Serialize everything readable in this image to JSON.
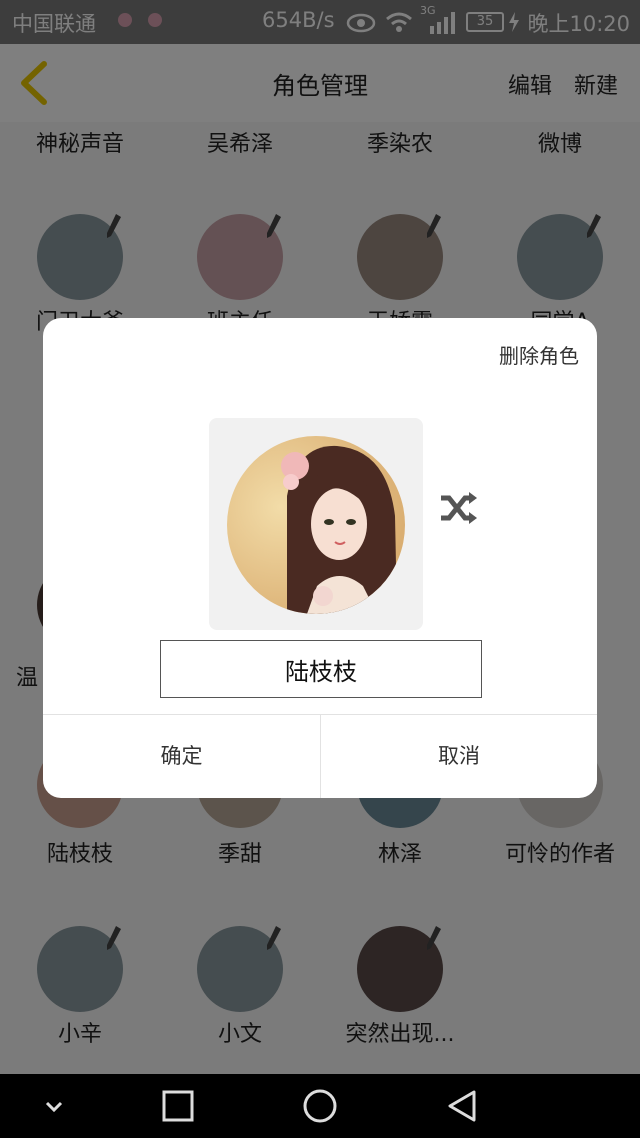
{
  "status_bar": {
    "carrier": "中国联通",
    "network_speed": "654B/s",
    "network_type": "3G",
    "battery": "35",
    "time": "晚上10:20"
  },
  "header": {
    "title": "角色管理",
    "edit_label": "编辑",
    "new_label": "新建",
    "back_icon": "chevron-left-icon",
    "accent_color": "#e8c700"
  },
  "grid": {
    "row0": [
      "神秘声音",
      "吴希泽",
      "季染农",
      "微博"
    ],
    "row1": [
      "门卫大爷",
      "班主任",
      "王娇霞",
      "同学A"
    ],
    "row2_left": "温",
    "row3": [
      "陆枝枝",
      "季甜",
      "林泽",
      "可怜的作者"
    ],
    "row4": [
      "小辛",
      "小文",
      "突然出现..."
    ]
  },
  "dialog": {
    "delete_label": "删除角色",
    "shuffle_icon": "shuffle-icon",
    "name_value": "陆枝枝",
    "confirm_label": "确定",
    "cancel_label": "取消"
  },
  "navbar": {
    "icons": [
      "chevron-down-icon",
      "square-icon",
      "circle-icon",
      "triangle-back-icon"
    ]
  }
}
